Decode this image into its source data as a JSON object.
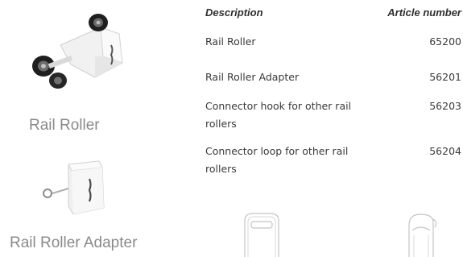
{
  "products": [
    {
      "caption": "Rail Roller"
    },
    {
      "caption": "Rail Roller Adapter"
    }
  ],
  "table": {
    "headers": {
      "description": "Description",
      "article_number": "Article number"
    },
    "rows": [
      {
        "description": "Rail Roller",
        "article_number": "65200"
      },
      {
        "description": "Rail Roller Adapter",
        "article_number": "56201"
      },
      {
        "description": "Connector hook for other rail rollers",
        "article_number": "56203"
      },
      {
        "description": "Connector loop for other rail rollers",
        "article_number": "56204"
      }
    ]
  }
}
